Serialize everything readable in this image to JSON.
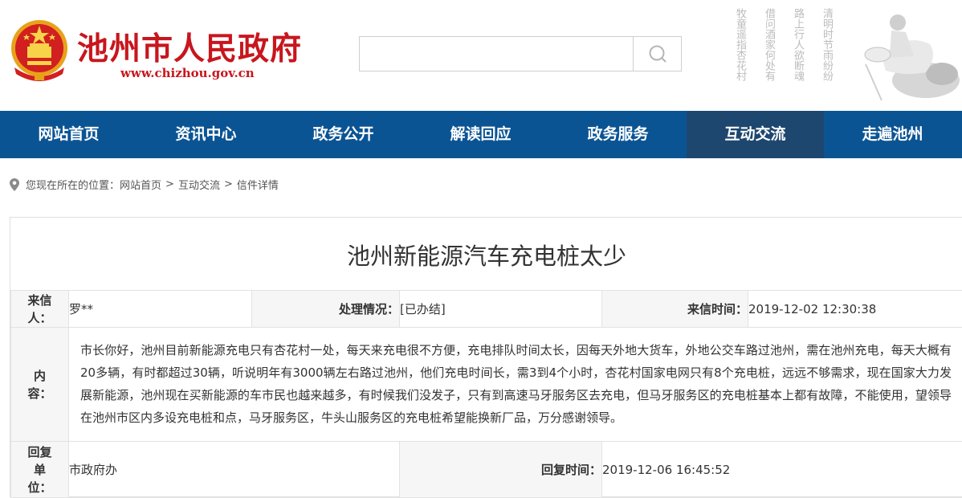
{
  "header": {
    "site_title": "池州市人民政府",
    "site_url": "www.chizhou.gov.cn",
    "search": {
      "placeholder": ""
    },
    "poem_lines": [
      "清明时节雨纷纷",
      "路上行人欲断魂",
      "借问酒家何处有",
      "牧童遥指杏花村"
    ]
  },
  "colors": {
    "brand_red": "#c8161d",
    "nav_bg": "#0b5494",
    "nav_active": "#1e4770",
    "status_green": "#3aa64a"
  },
  "nav": {
    "items": [
      {
        "label": "网站首页"
      },
      {
        "label": "资讯中心"
      },
      {
        "label": "政务公开"
      },
      {
        "label": "解读回应"
      },
      {
        "label": "政务服务"
      },
      {
        "label": "互动交流"
      },
      {
        "label": "走遍池州"
      }
    ],
    "active": "互动交流"
  },
  "breadcrumb": {
    "prefix": "您现在所在的位置：",
    "items": [
      "网站首页",
      "互动交流",
      "信件详情"
    ],
    "separator": ">"
  },
  "letter": {
    "title": "池州新能源汽车充电桩太少",
    "sender_label_1": "来信",
    "sender_label_2": "人：",
    "sender": "罗**",
    "status_label": "处理情况：",
    "status": "[已办结]",
    "time_label": "来信时间：",
    "time": "2019-12-02 12:30:38",
    "content_label_1": "内",
    "content_label_2": "容：",
    "content": "市长你好，池州目前新能源充电只有杏花村一处，每天来充电很不方便，充电排队时间太长，因每天外地大货车，外地公交车路过池州，需在池州充电，每天大概有20多辆，有时都超过30辆，听说明年有3000辆左右路过池州，他们充电时间长，需3到4个小时，杏花村国家电网只有8个充电桩，远远不够需求，现在国家大力发展新能源，池州现在买新能源的车市民也越来越多，有时候我们没发子，只有到高速马牙服务区去充电，但马牙服务区的充电桩基本上都有故障，不能使用，望领导在池州市区内多设充电桩和点，马牙服务区，牛头山服务区的充电桩希望能换新厂品，万分感谢领导。",
    "reply_label_1": "回复",
    "reply_label_2": "单",
    "reply_label_3": "位：",
    "reply_unit": "市政府办",
    "reply_time_label": "回复时间：",
    "reply_time": "2019-12-06 16:45:52"
  }
}
